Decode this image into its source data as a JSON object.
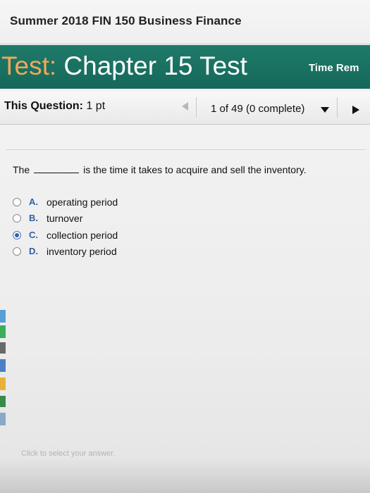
{
  "course": {
    "title": "Summer 2018 FIN 150 Business Finance"
  },
  "test": {
    "title_prefix": "Test:",
    "title": "Chapter 15 Test",
    "time_remaining_label": "Time Rem"
  },
  "question_bar": {
    "label": "This Question:",
    "points": "1 pt",
    "counter": "1 of 49 (0 complete)"
  },
  "question": {
    "text_before": "The",
    "text_after": "is the time it takes to acquire and sell the inventory.",
    "options": [
      {
        "letter": "A.",
        "text": "operating period",
        "selected": false
      },
      {
        "letter": "B.",
        "text": "turnover",
        "selected": false
      },
      {
        "letter": "C.",
        "text": "collection period",
        "selected": true
      },
      {
        "letter": "D.",
        "text": "inventory period",
        "selected": false
      }
    ]
  },
  "hint": "Click to select your answer.",
  "colors": {
    "header_bg": "#1f7a6a",
    "title_prefix": "#f0a85b",
    "option_letter": "#2f5fa8",
    "radio_selected": "#2f5fb0"
  }
}
